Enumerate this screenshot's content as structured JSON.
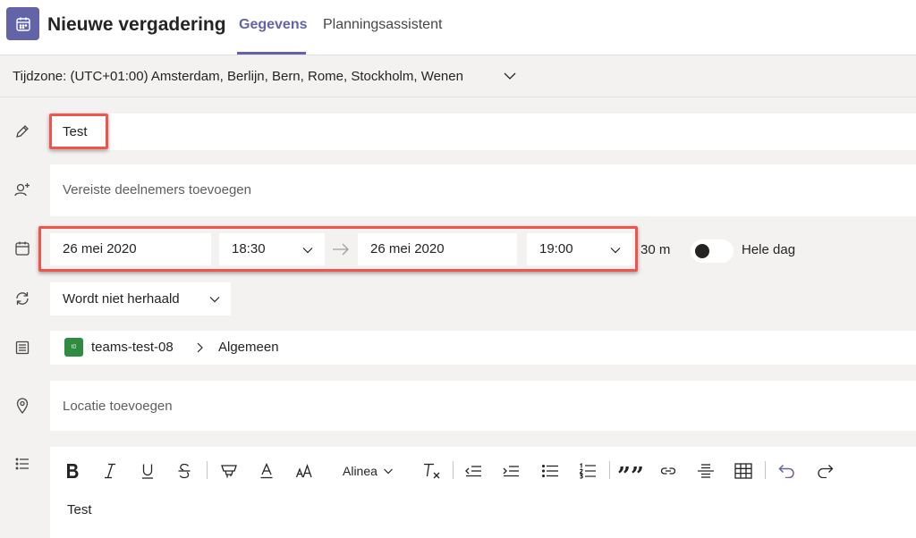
{
  "header": {
    "title": "Nieuwe vergadering",
    "tabs": [
      {
        "label": "Gegevens",
        "active": true
      },
      {
        "label": "Planningsassistent",
        "active": false
      }
    ]
  },
  "timezone": {
    "label": "Tijdzone: (UTC+01:00) Amsterdam, Berlijn, Bern, Rome, Stockholm, Wenen"
  },
  "meeting": {
    "title_value": "Test",
    "attendees_placeholder": "Vereiste deelnemers toevoegen",
    "start_date": "26 mei 2020",
    "start_time": "18:30",
    "end_date": "26 mei 2020",
    "end_time": "19:00",
    "duration": "30 m",
    "all_day_label": "Hele dag",
    "all_day": false,
    "recurrence": "Wordt niet herhaald",
    "team_badge": "t0",
    "team_name": "teams-test-08",
    "channel_name": "Algemeen",
    "location_placeholder": "Locatie toevoegen"
  },
  "editor": {
    "paragraph_style": "Alinea",
    "body_text": "Test",
    "quote_glyph": "””"
  },
  "colors": {
    "accent": "#6264a7",
    "highlight": "#f2534a",
    "team_badge": "#2e8b40"
  }
}
